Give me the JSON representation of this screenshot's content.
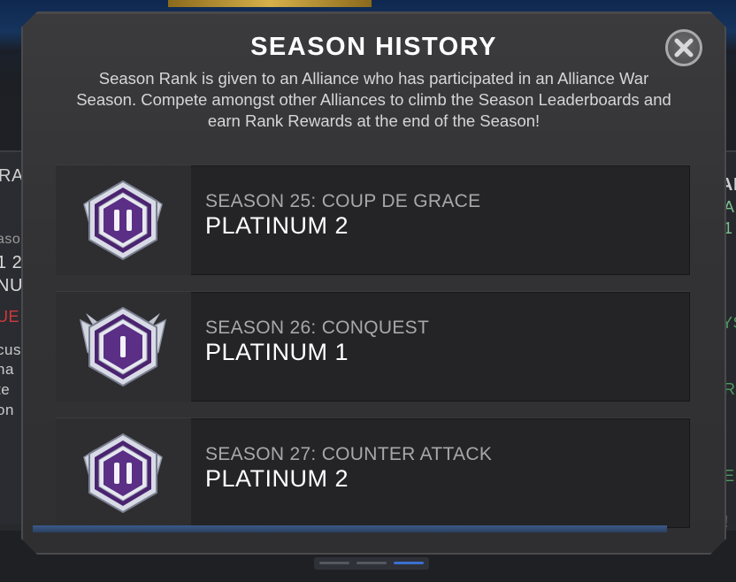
{
  "modal": {
    "title": "SEASON HISTORY",
    "description": "Season Rank is given to an Alliance who has participated in an Alliance War Season. Compete amongst other Alliances to climb the Season Leaderboards and earn Rank Rewards at the end of the Season!",
    "close_icon": "close-icon"
  },
  "seasons": [
    {
      "season": "SEASON 25: COUP DE GRACE",
      "rank": "PLATINUM 2",
      "badge_numeral": "II",
      "badge_icon": "platinum-rank-badge-icon"
    },
    {
      "season": "SEASON 26: CONQUEST",
      "rank": "PLATINUM 1",
      "badge_numeral": "I",
      "badge_icon": "platinum-rank-badge-icon"
    },
    {
      "season": "SEASON 27: COUNTER ATTACK",
      "rank": "PLATINUM 2",
      "badge_numeral": "II",
      "badge_icon": "platinum-rank-badge-icon"
    }
  ],
  "background": {
    "left_fragments": [
      "RA",
      "aso",
      "1 2",
      "NU",
      "UE",
      "cus",
      "na",
      "te",
      "on"
    ],
    "right_fragments": [
      "AR",
      "A",
      "1",
      "YS",
      "R",
      "E",
      "!"
    ]
  },
  "colors": {
    "badge_purple": "#5b2f86",
    "badge_silver": "#d8dbe6",
    "title_white": "#ffffff",
    "season_gray": "#a8a8a8"
  }
}
